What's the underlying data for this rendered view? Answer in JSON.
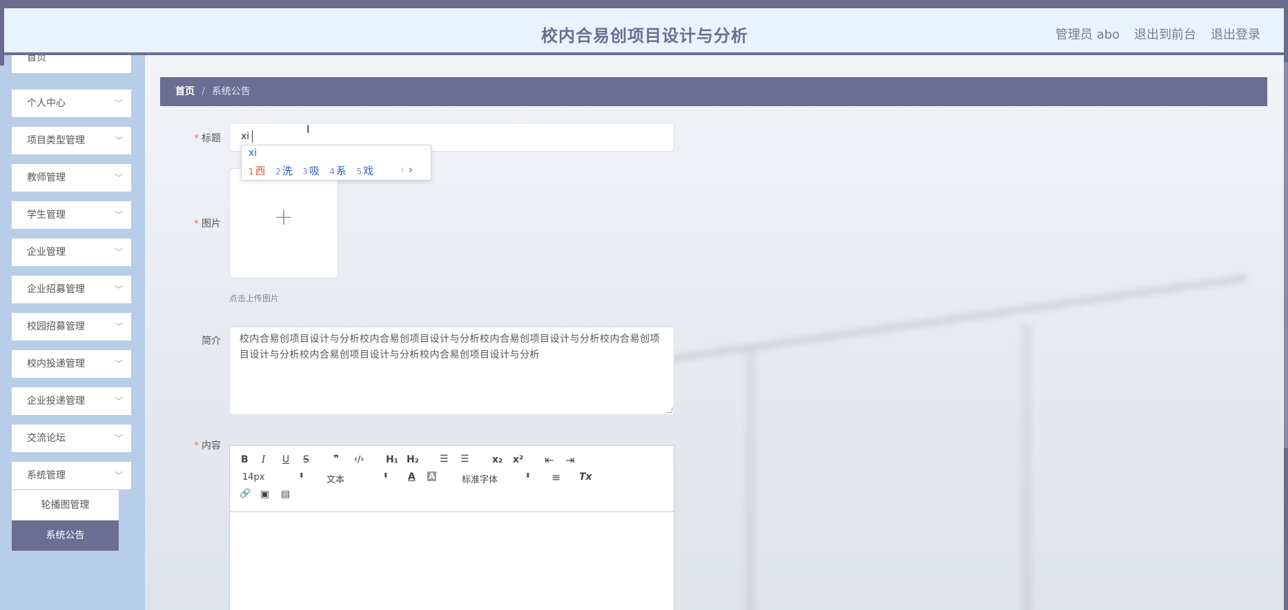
{
  "header": {
    "title": "校内合易创项目设计与分析",
    "admin": "管理员 abo",
    "to_front": "退出到前台",
    "logout": "退出登录"
  },
  "sidebar": {
    "items": [
      {
        "label": "首页"
      },
      {
        "label": "个人中心"
      },
      {
        "label": "项目类型管理"
      },
      {
        "label": "教师管理"
      },
      {
        "label": "学生管理"
      },
      {
        "label": "企业管理"
      },
      {
        "label": "企业招募管理"
      },
      {
        "label": "校园招募管理"
      },
      {
        "label": "校内投递管理"
      },
      {
        "label": "企业投递管理"
      },
      {
        "label": "交流论坛"
      },
      {
        "label": "系统管理"
      }
    ],
    "sub_items": [
      {
        "label": "轮播图管理"
      },
      {
        "label": "系统公告"
      }
    ]
  },
  "breadcrumb": {
    "home": "首页",
    "separator": "/",
    "current": "系统公告"
  },
  "form": {
    "title_label": "标题",
    "title_value": "xi",
    "image_label": "图片",
    "image_hint": "点击上传图片",
    "intro_label": "简介",
    "intro_value": "校内合易创项目设计与分析校内合易创项目设计与分析校内合易创项目设计与分析校内合易创项目设计与分析校内合易创项目设计与分析校内合易创项目设计与分析",
    "content_label": "内容",
    "required_mark": "*"
  },
  "ime": {
    "composition": "xi",
    "candidates": [
      {
        "n": "1",
        "c": "西"
      },
      {
        "n": "2",
        "c": "洗"
      },
      {
        "n": "3",
        "c": "吸"
      },
      {
        "n": "4",
        "c": "系"
      },
      {
        "n": "5",
        "c": "戏"
      }
    ],
    "prev": "‹",
    "next": "›"
  },
  "editor": {
    "font_size": "14px",
    "header_select": "文本",
    "font_family": "标准字体",
    "buttons": {
      "bold": "B",
      "italic": "I",
      "underline": "U",
      "strike": "S",
      "quote": "❞",
      "code": "‹/›",
      "h1": "H₁",
      "h2": "H₂",
      "ol": "☰",
      "ul": "☰",
      "sub": "x₂",
      "sup": "x²",
      "outdent": "⇤",
      "indent": "⇥",
      "color": "A",
      "background": "A",
      "align": "≡",
      "clean": "Tx",
      "link": "🔗",
      "image": "▣",
      "video": "▤"
    }
  },
  "colors": {
    "accent": "#6b6d93",
    "sidebar_bg": "#b8cde8",
    "header_bg": "#e8f4fd",
    "required": "#f56c6c"
  }
}
